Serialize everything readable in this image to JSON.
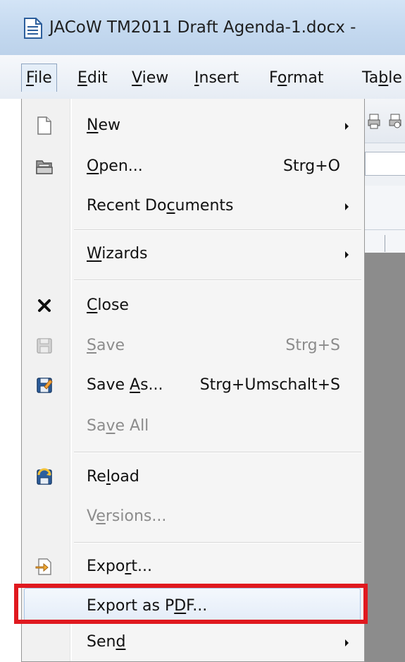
{
  "window": {
    "title": "JACoW TM2011 Draft Agenda-1.docx -",
    "icon": "document-icon"
  },
  "menubar": {
    "items": [
      {
        "label": "File",
        "underline": "F",
        "active": true
      },
      {
        "label": "Edit",
        "underline": "E"
      },
      {
        "label": "View",
        "underline": "V"
      },
      {
        "label": "Insert",
        "underline": "I"
      },
      {
        "label": "Format",
        "underline": "o"
      },
      {
        "label": "Table",
        "underline": "b"
      }
    ]
  },
  "file_menu": {
    "items": [
      {
        "label": "New",
        "icon": "new-document-icon",
        "submenu": true
      },
      {
        "label": "Open...",
        "icon": "open-folder-icon",
        "shortcut": "Strg+O"
      },
      {
        "label": "Recent Documents",
        "submenu": true
      },
      {
        "label": "Wizards",
        "submenu": true
      },
      {
        "label": "Close",
        "icon": "close-x-icon"
      },
      {
        "label": "Save",
        "icon": "save-disk-icon",
        "shortcut": "Strg+S",
        "disabled": true
      },
      {
        "label": "Save As...",
        "icon": "save-as-icon",
        "shortcut": "Strg+Umschalt+S"
      },
      {
        "label": "Save All",
        "disabled": true
      },
      {
        "label": "Reload",
        "icon": "reload-icon"
      },
      {
        "label": "Versions...",
        "disabled": true
      },
      {
        "label": "Export...",
        "icon": "export-icon"
      },
      {
        "label": "Export as PDF...",
        "highlighted": true
      },
      {
        "label": "Send",
        "submenu": true
      }
    ]
  },
  "colors": {
    "highlight_border": "#e0191f",
    "disabled_text": "#8c8c8c"
  }
}
